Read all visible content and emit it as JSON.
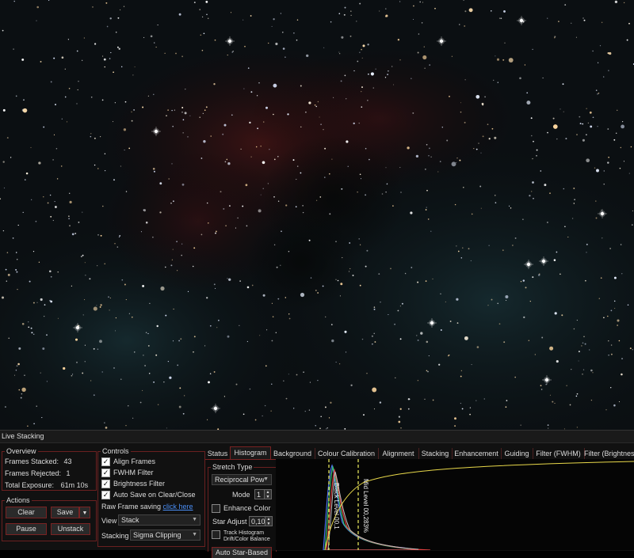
{
  "image_view": {
    "alt": "stacked astronomy image"
  },
  "panel": {
    "title": "Live Stacking",
    "overview": {
      "label": "Overview",
      "frames_stacked_label": "Frames Stacked:",
      "frames_stacked_value": "43",
      "frames_rejected_label": "Frames Rejected:",
      "frames_rejected_value": "1",
      "total_exposure_label": "Total Exposure:",
      "total_exposure_value": "61m 10s"
    },
    "actions": {
      "label": "Actions",
      "clear": "Clear",
      "save": "Save",
      "pause": "Pause",
      "unstack": "Unstack"
    },
    "controls": {
      "label": "Controls",
      "align_frames": "Align Frames",
      "fwhm_filter": "FWHM Filter",
      "brightness_filter": "Brightness Filter",
      "auto_save": "Auto Save on Clear/Close",
      "raw_frame_label": "Raw Frame saving",
      "raw_frame_link": "click here",
      "view_label": "View",
      "view_value": "Stack",
      "stacking_label": "Stacking",
      "stacking_value": "Sigma Clipping"
    },
    "tabs": [
      {
        "label": "Status"
      },
      {
        "label": "Histogram"
      },
      {
        "label": "Background"
      },
      {
        "label": "Colour Calibration"
      },
      {
        "label": "Alignment"
      },
      {
        "label": "Stacking"
      },
      {
        "label": "Enhancement"
      },
      {
        "label": "Guiding"
      },
      {
        "label": "Filter (FWHM)"
      },
      {
        "label": "Filter (Brightness"
      }
    ],
    "histogram": {
      "stretch_type_label": "Stretch Type",
      "stretch_type_value": "Reciprocal Pow",
      "mode_label": "Mode",
      "mode_value": "1",
      "enhance_color_label": "Enhance Color",
      "star_adjust_label": "Star Adjust",
      "star_adjust_value": "0,10",
      "track_histogram_label_1": "Track Histogram",
      "track_histogram_label_2": "Drift/Color Balance",
      "auto_star_button": "Auto Star-Based",
      "black_level_label": "Black Level 00,1",
      "mid_level_label": "Mid Level 00,283%"
    },
    "colors": {
      "accent_border": "#7a2222",
      "link": "#4a8ef5",
      "curve": "#e8d84a"
    }
  }
}
